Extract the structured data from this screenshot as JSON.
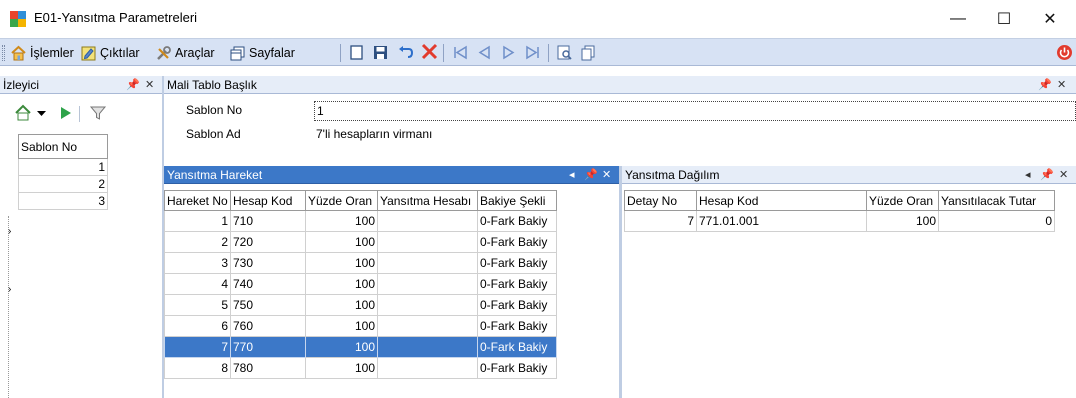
{
  "window": {
    "title": "E01-Yansıtma Parametreleri",
    "min_glyph": "—",
    "max_glyph": "☐",
    "close_glyph": "✕"
  },
  "toolbar": {
    "islemler": "İşlemler",
    "ciktilar": "Çıktılar",
    "araclar": "Araçlar",
    "sayfalar": "Sayfalar"
  },
  "izleyici": {
    "title": "İzleyici",
    "column": "Sablon No",
    "rows": [
      "1",
      "2",
      "3"
    ]
  },
  "mali_tablo": {
    "title": "Mali Tablo Başlık",
    "sablon_no_label": "Sablon No",
    "sablon_no_value": "1",
    "sablon_ad_label": "Sablon Ad",
    "sablon_ad_value": "7'li hesapların virmanı"
  },
  "yansitma_hareket": {
    "title": "Yansıtma Hareket",
    "columns": [
      "Hareket No",
      "Hesap Kod",
      "Yüzde Oran",
      "Yansıtma Hesabı",
      "Bakiye Şekli"
    ],
    "rows": [
      [
        "1",
        "710",
        "100",
        "",
        "0-Fark Bakiy"
      ],
      [
        "2",
        "720",
        "100",
        "",
        "0-Fark Bakiy"
      ],
      [
        "3",
        "730",
        "100",
        "",
        "0-Fark Bakiy"
      ],
      [
        "4",
        "740",
        "100",
        "",
        "0-Fark Bakiy"
      ],
      [
        "5",
        "750",
        "100",
        "",
        "0-Fark Bakiy"
      ],
      [
        "6",
        "760",
        "100",
        "",
        "0-Fark Bakiy"
      ],
      [
        "7",
        "770",
        "100",
        "",
        "0-Fark Bakiy"
      ],
      [
        "8",
        "780",
        "100",
        "",
        "0-Fark Bakiy"
      ]
    ],
    "selected_row": 6
  },
  "yansitma_dagilim": {
    "title": "Yansıtma Dağılım",
    "columns": [
      "Detay No",
      "Hesap Kod",
      "Yüzde Oran",
      "Yansıtılacak Tutar"
    ],
    "rows": [
      [
        "7",
        "771.01.001",
        "100",
        "0"
      ]
    ]
  },
  "colors": {
    "toolbar_bg": "#d7e2f4",
    "selection": "#3c78c8",
    "close_red": "#e23b2e"
  }
}
